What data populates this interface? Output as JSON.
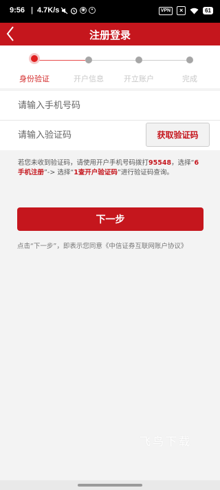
{
  "status_bar": {
    "time": "9:56",
    "separator": "|",
    "network_speed": "4.7K/s",
    "vpn": "VPN",
    "battery": "61"
  },
  "header": {
    "title": "注册登录",
    "bg_color": "#c5161d"
  },
  "steps": [
    {
      "label": "身份验证",
      "active": true
    },
    {
      "label": "开户信息",
      "active": false
    },
    {
      "label": "开立账户",
      "active": false
    },
    {
      "label": "完成",
      "active": false
    }
  ],
  "form": {
    "phone_placeholder": "请输入手机号码",
    "code_placeholder": "请输入验证码",
    "get_code_label": "获取验证码"
  },
  "notice": {
    "part1": "若您未收到验证码，请使用开户手机号码拨打",
    "hotline": "95548",
    "part2": "，选择“",
    "option1": "6手机注册",
    "part3": "”-> 选择“",
    "option2": "1查开户验证码",
    "part4": "”进行验证码查询。"
  },
  "next_button_label": "下一步",
  "agreement_text": "点击“下一步”，即表示您同意《中信证券互联网账户协议》",
  "watermark": "飞鸟下载"
}
